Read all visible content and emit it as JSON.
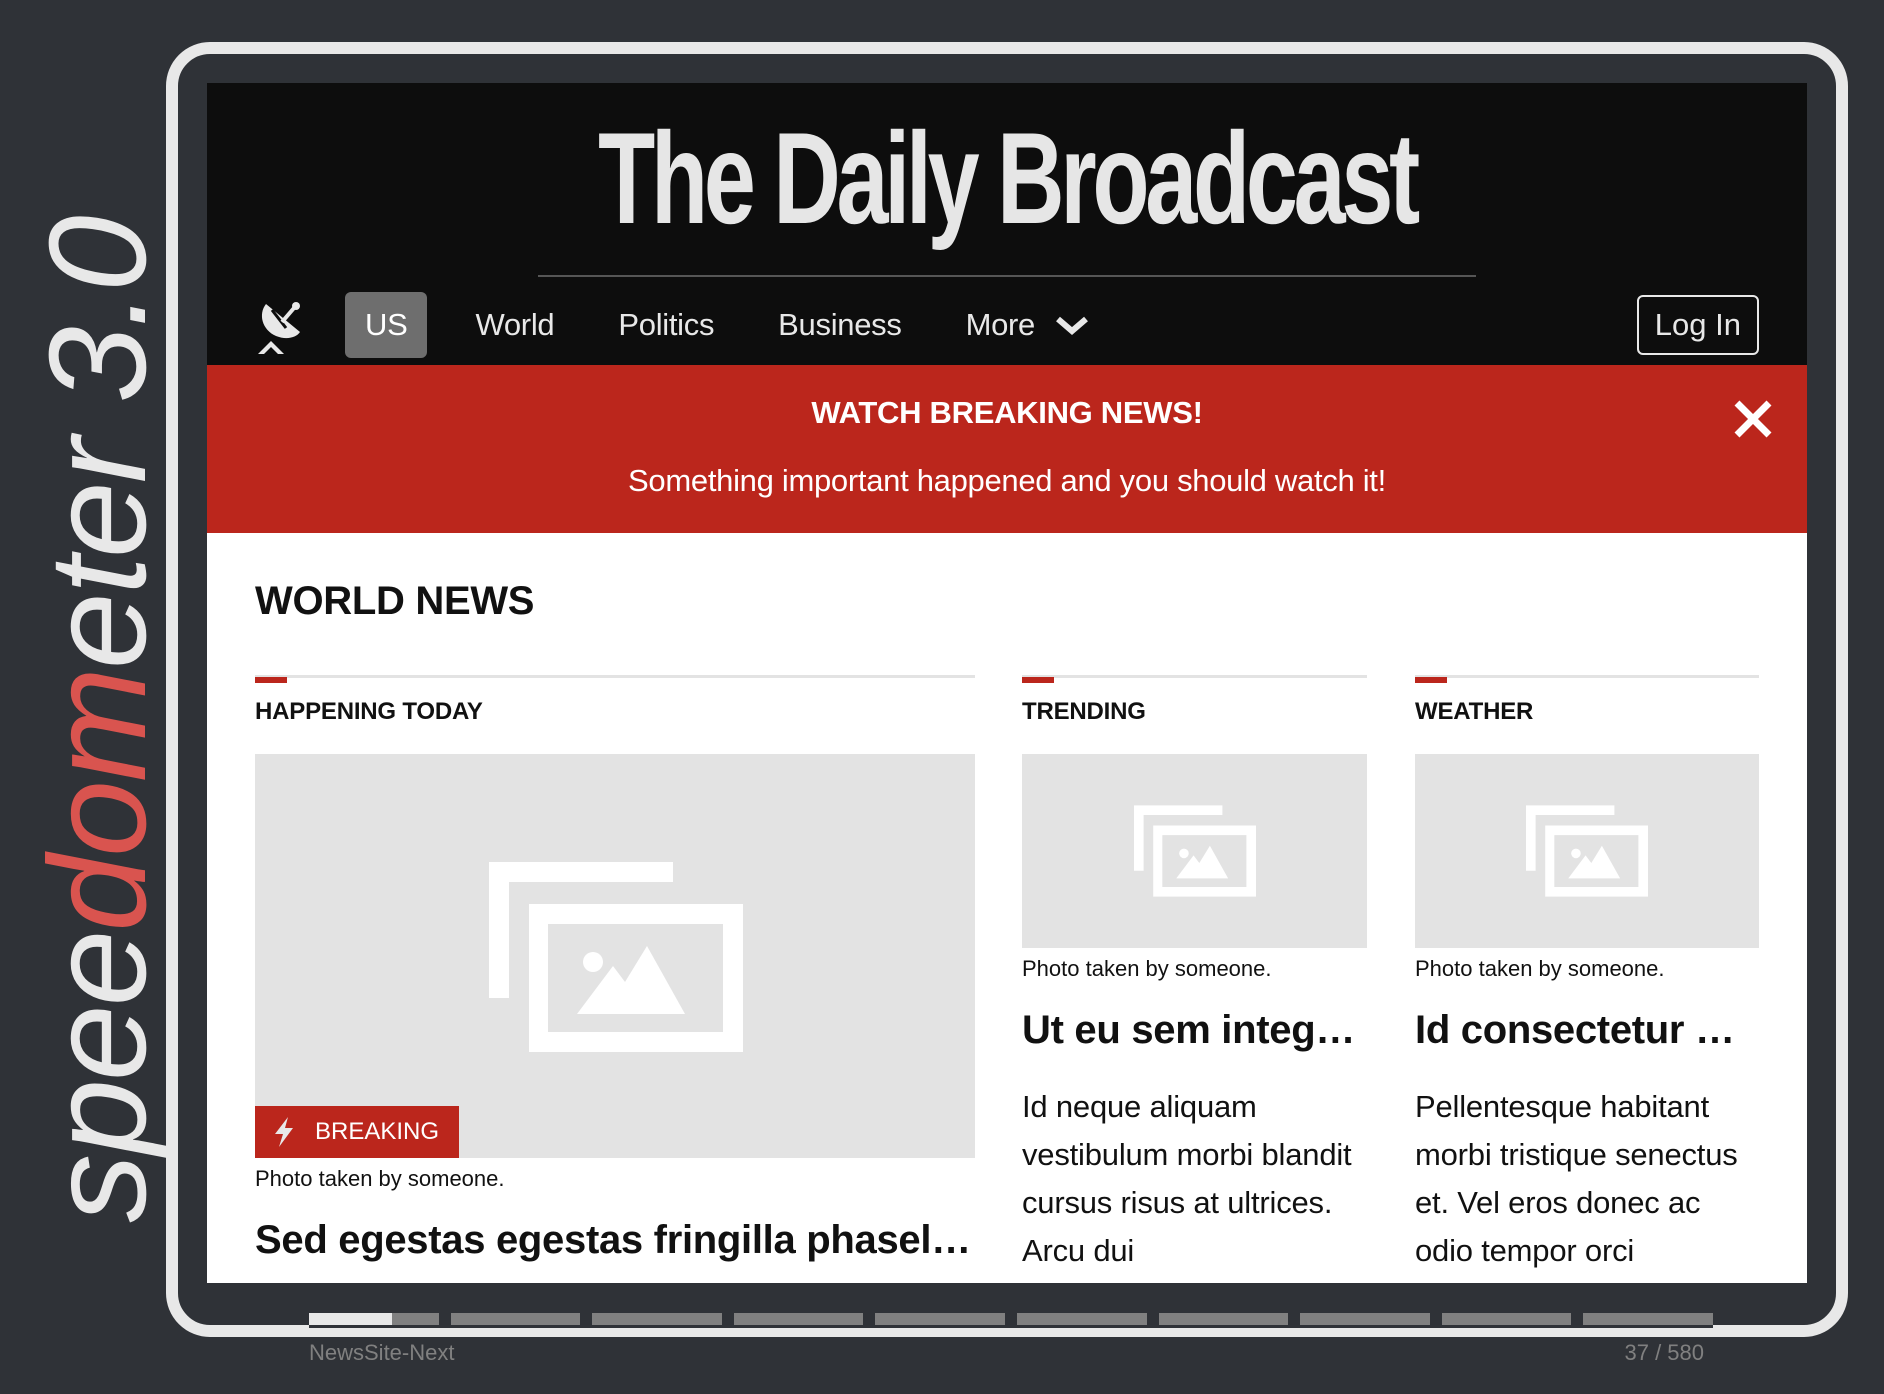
{
  "branding": {
    "logo_part1": "spee",
    "logo_part2": "dom",
    "logo_part3": "eter 3.0",
    "accent_color": "#d9544f"
  },
  "footer": {
    "suite_name": "NewsSite-Next",
    "step_counter": "37 / 580",
    "progress_fraction": 0.0638
  },
  "site": {
    "title": "The Daily Broadcast",
    "nav": {
      "items": [
        {
          "label": "US",
          "active": true
        },
        {
          "label": "World",
          "active": false
        },
        {
          "label": "Politics",
          "active": false
        },
        {
          "label": "Business",
          "active": false
        }
      ],
      "more_label": "More",
      "login_label": "Log In"
    },
    "banner": {
      "title": "WATCH BREAKING NEWS!",
      "text": "Something important happened and you should watch it!",
      "color": "#bb261c"
    },
    "section_title": "WORLD NEWS",
    "columns": [
      {
        "heading": "HAPPENING TODAY",
        "tag": "BREAKING",
        "caption": "Photo taken by someone.",
        "headline": "Sed egestas egestas fringilla phasellus faucibus scelerisque",
        "body": ""
      },
      {
        "heading": "TRENDING",
        "caption": "Photo taken by someone.",
        "headline": "Ut eu sem integer vitae justo",
        "body": "Id neque aliquam vestibulum morbi blandit cursus risus at ultrices. Arcu dui"
      },
      {
        "heading": "WEATHER",
        "caption": "Photo taken by someone.",
        "headline": "Id consectetur purus ut faucibus",
        "body": "Pellentesque habitant morbi tristique senectus et. Vel eros donec ac odio tempor orci"
      }
    ]
  }
}
